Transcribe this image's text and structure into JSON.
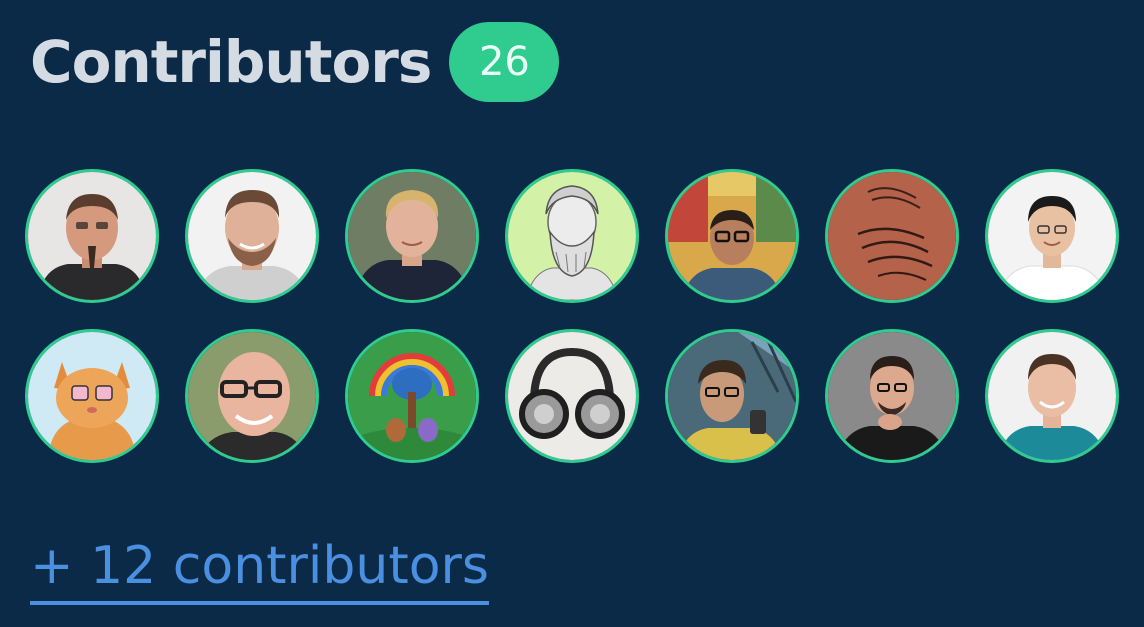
{
  "header": {
    "title": "Contributors",
    "count": "26"
  },
  "avatars": [
    {
      "icon": "avatar-photo",
      "subject": "man-with-goatee"
    },
    {
      "icon": "avatar-photo",
      "subject": "smiling-man-with-beard"
    },
    {
      "icon": "avatar-photo",
      "subject": "blond-man-in-hoodie"
    },
    {
      "icon": "avatar-photo",
      "subject": "bearded-philosopher-bust"
    },
    {
      "icon": "avatar-photo",
      "subject": "man-with-glasses-by-mural"
    },
    {
      "icon": "avatar-photo",
      "subject": "scribble-drawing"
    },
    {
      "icon": "avatar-photo",
      "subject": "smiling-man-white-shirt"
    },
    {
      "icon": "avatar-photo",
      "subject": "orange-cat-with-glasses"
    },
    {
      "icon": "avatar-photo",
      "subject": "bald-man-with-glasses"
    },
    {
      "icon": "avatar-photo",
      "subject": "rainbow-tree-painting"
    },
    {
      "icon": "avatar-photo",
      "subject": "headphones"
    },
    {
      "icon": "avatar-photo",
      "subject": "man-with-glasses-outdoors"
    },
    {
      "icon": "avatar-photo",
      "subject": "man-with-hand-on-chin"
    },
    {
      "icon": "avatar-photo",
      "subject": "smiling-man-teal-shirt"
    }
  ],
  "more": {
    "label": "+ 12 contributors"
  },
  "colors": {
    "background": "#0b2a48",
    "accent": "#2fcb8f",
    "link": "#4a8fe0",
    "title": "#d5dbe3"
  }
}
